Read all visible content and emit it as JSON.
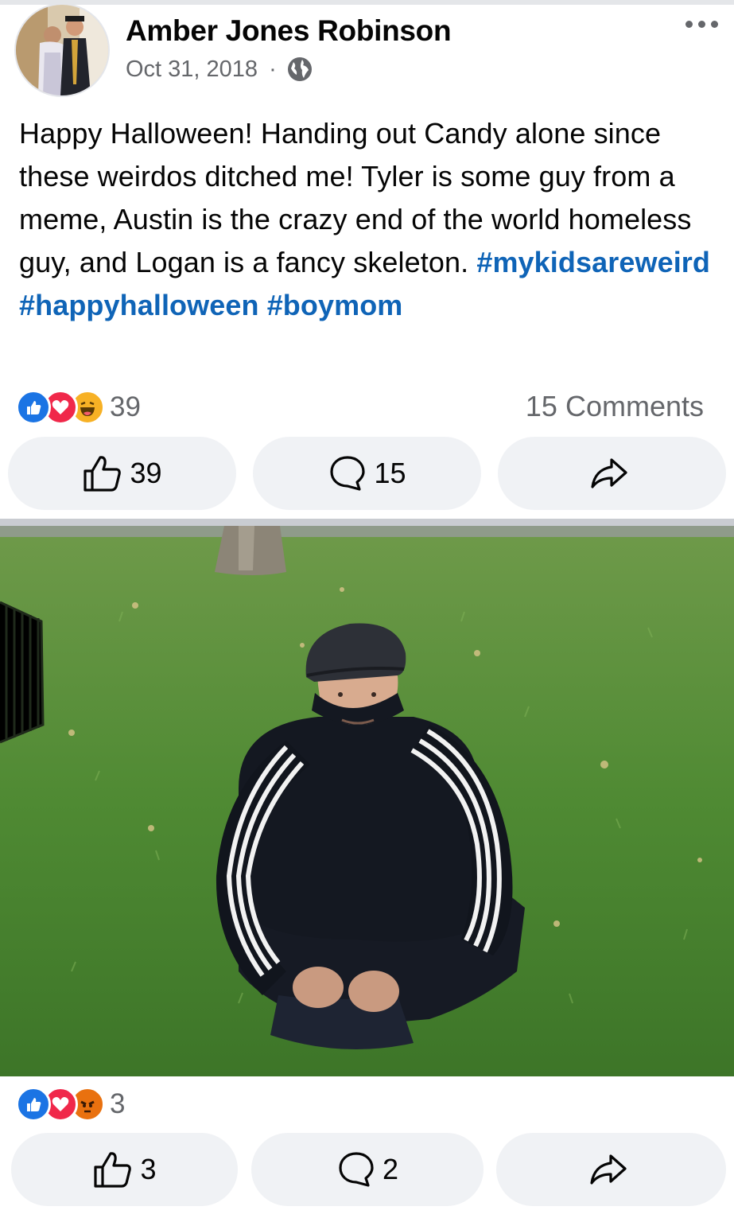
{
  "post": {
    "author": "Amber Jones Robinson",
    "date": "Oct 31, 2018",
    "separator": "·",
    "text_body": "Happy Halloween! Handing out Candy alone since these weirdos ditched me! Tyler is some guy from a meme, Austin is the crazy end of the world homeless guy, and Logan is a fancy skeleton.",
    "hashtags": [
      "#mykidsareweird",
      "#happyhalloween",
      "#boymom"
    ],
    "reactions": {
      "icons": [
        "like-reaction",
        "love-reaction",
        "haha-reaction"
      ],
      "count": "39"
    },
    "comments_label": "15 Comments",
    "actions": {
      "like_count": "39",
      "comment_count": "15"
    }
  },
  "photo": {
    "reactions": {
      "icons": [
        "like-reaction",
        "love-reaction",
        "angry-reaction"
      ],
      "count": "3"
    },
    "actions": {
      "like_count": "3",
      "comment_count": "2"
    }
  },
  "colors": {
    "hashtag": "#0f64b7",
    "like": "#1b74e4",
    "love": "#f0284a",
    "haha": "#f7b125",
    "angry": "#e9710f",
    "button_bg": "#f0f2f5",
    "secondary_text": "#65676b"
  }
}
